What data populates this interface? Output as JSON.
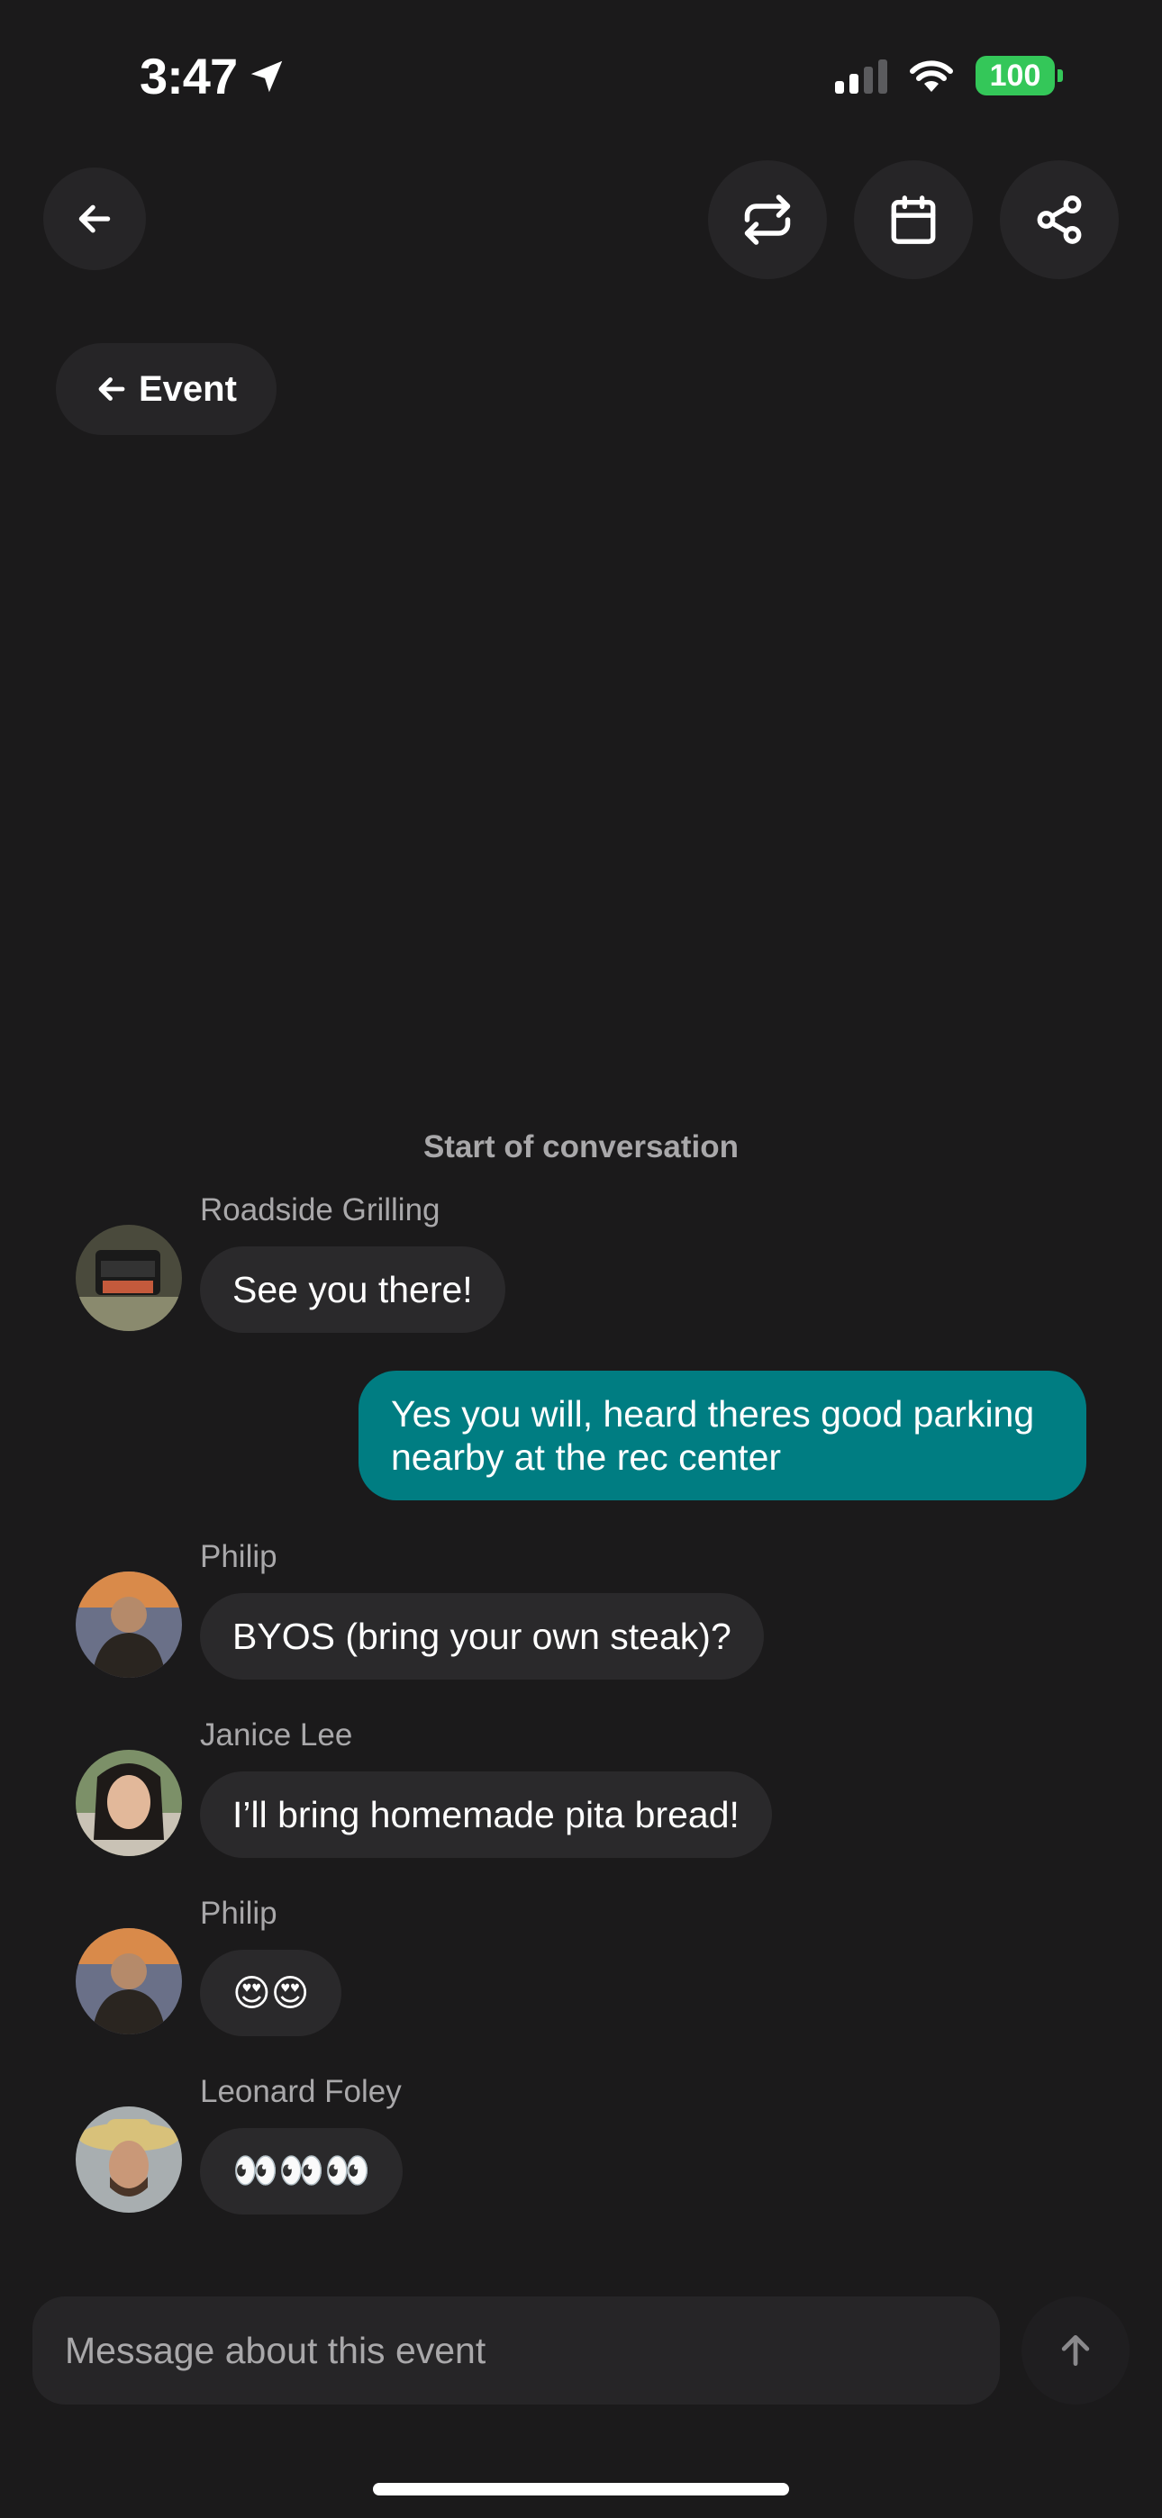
{
  "status_bar": {
    "time": "3:47",
    "battery": "100",
    "location_icon": "location-arrow-icon",
    "signal_icon": "cellular-signal-icon",
    "wifi_icon": "wifi-icon"
  },
  "toolbar": {
    "back_icon": "arrow-left-icon",
    "repeat_icon": "repeat-icon",
    "calendar_icon": "calendar-icon",
    "share_icon": "share-icon"
  },
  "event_link": {
    "label": "Event",
    "icon": "arrow-left-icon"
  },
  "conversation": {
    "start_label": "Start of conversation",
    "messages": [
      {
        "sender": "Roadside Grilling",
        "text": "See you there!"
      },
      {
        "sender": "",
        "text": "Yes you will, heard theres good parking nearby at the rec center",
        "outgoing": true
      },
      {
        "sender": "Philip",
        "text": "BYOS (bring your own steak)?"
      },
      {
        "sender": "Janice Lee",
        "text": "I’ll bring homemade pita bread!"
      },
      {
        "sender": "Philip",
        "text": "😍😍"
      },
      {
        "sender": "Leonard Foley",
        "text": "👀👀👀"
      }
    ]
  },
  "composer": {
    "placeholder": "Message about this event",
    "send_icon": "arrow-up-icon"
  },
  "colors": {
    "background": "#1b1a1b",
    "bubble": "#2a292b",
    "outgoing_bubble": "#007d82",
    "battery": "#34c759"
  }
}
